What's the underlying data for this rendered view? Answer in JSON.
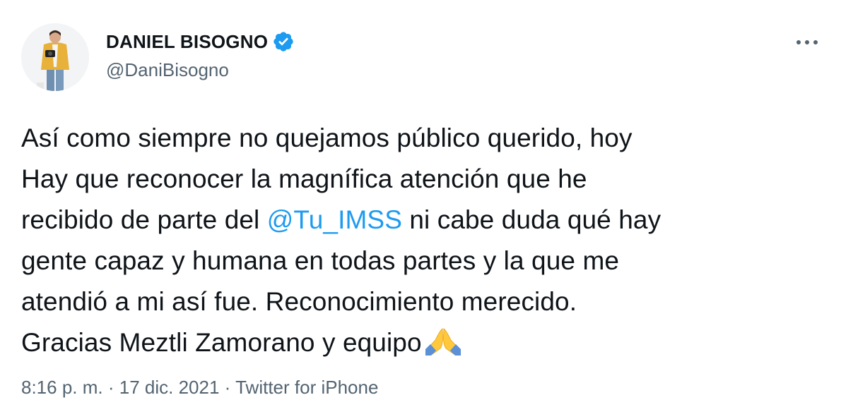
{
  "author": {
    "display_name": "DANIEL BISOGNO",
    "handle": "@DaniBisogno",
    "verified": true
  },
  "tweet": {
    "lines": [
      {
        "text": "Así como siempre no quejamos público querido, hoy"
      },
      {
        "text": "Hay que reconocer la magnífica atención que he"
      },
      {
        "before": "recibido de parte del ",
        "mention": "@Tu_IMSS",
        "after": " ni cabe duda qué hay"
      },
      {
        "text": "gente capaz y humana en todas partes y la que me"
      },
      {
        "text": "atendió a mi así fue. Reconocimiento merecido."
      },
      {
        "text": "Gracias Meztli Zamorano y equipo"
      }
    ],
    "emoji": "folded-hands"
  },
  "meta": {
    "time": "8:16 p. m.",
    "separator": "·",
    "date": "17 dic. 2021",
    "source": "Twitter for iPhone"
  },
  "colors": {
    "text": "#0f1419",
    "secondary": "#536471",
    "link": "#1d9bf0",
    "verified": "#1d9bf0"
  }
}
